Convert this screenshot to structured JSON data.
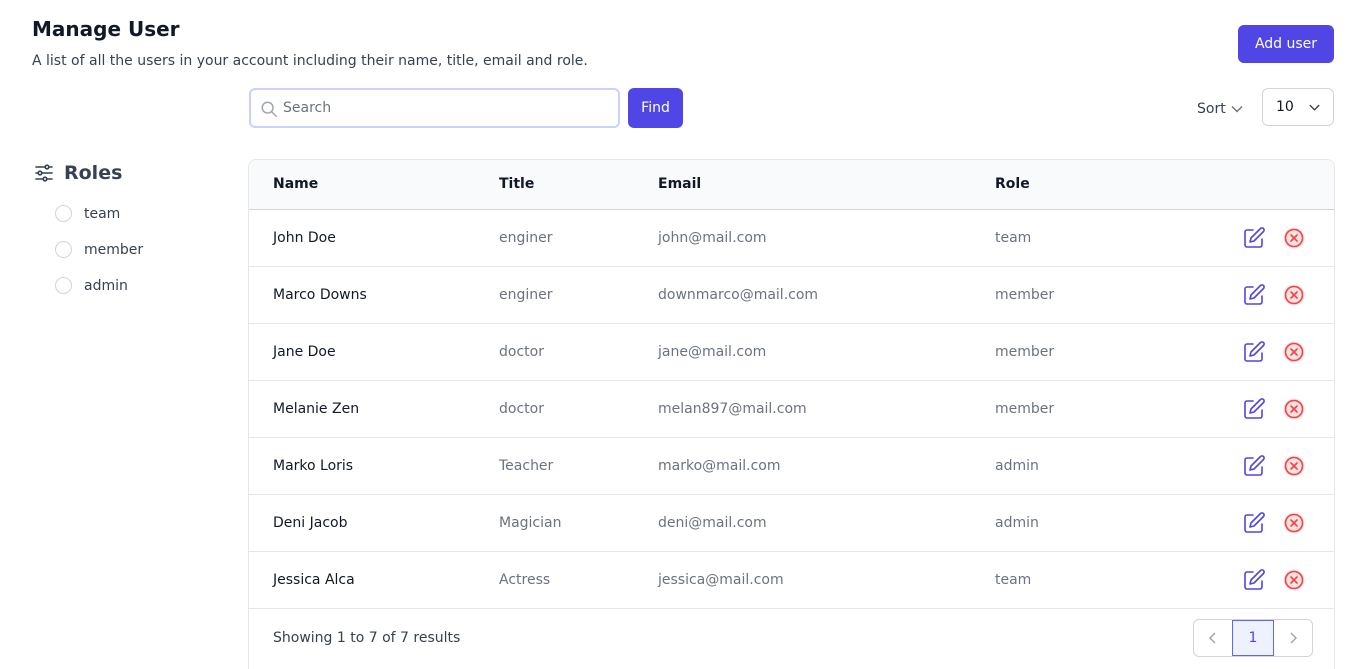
{
  "header": {
    "title": "Manage User",
    "subtitle": "A list of all the users in your account including their name, title, email and role.",
    "add_user_label": "Add user"
  },
  "search": {
    "placeholder": "Search",
    "value": "",
    "button_label": "Find"
  },
  "sort": {
    "label": "Sort",
    "per_page": "10"
  },
  "roles": {
    "title": "Roles",
    "options": [
      "team",
      "member",
      "admin"
    ]
  },
  "table": {
    "columns": [
      "Name",
      "Title",
      "Email",
      "Role"
    ],
    "rows": [
      {
        "name": "John Doe",
        "title": "enginer",
        "email": "john@mail.com",
        "role": "team"
      },
      {
        "name": "Marco Downs",
        "title": "enginer",
        "email": "downmarco@mail.com",
        "role": "member"
      },
      {
        "name": "Jane Doe",
        "title": "doctor",
        "email": "jane@mail.com",
        "role": "member"
      },
      {
        "name": "Melanie Zen",
        "title": "doctor",
        "email": "melan897@mail.com",
        "role": "member"
      },
      {
        "name": "Marko Loris",
        "title": "Teacher",
        "email": "marko@mail.com",
        "role": "admin"
      },
      {
        "name": "Deni Jacob",
        "title": "Magician",
        "email": "deni@mail.com",
        "role": "admin"
      },
      {
        "name": "Jessica Alca",
        "title": "Actress",
        "email": "jessica@mail.com",
        "role": "team"
      }
    ]
  },
  "pagination": {
    "summary": "Showing 1 to 7 of 7 results",
    "current_page": "1"
  },
  "colors": {
    "accent": "#4f46e5",
    "danger": "#ef4444"
  }
}
